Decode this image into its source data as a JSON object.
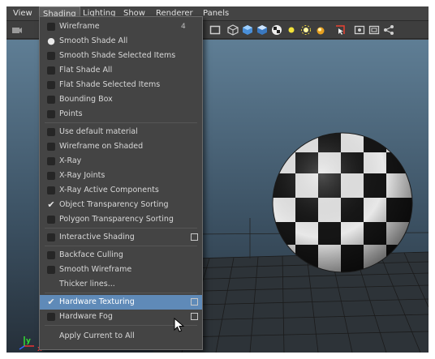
{
  "menubar": {
    "items": [
      {
        "label": "View"
      },
      {
        "label": "Shading"
      },
      {
        "label": "Lighting"
      },
      {
        "label": "Show"
      },
      {
        "label": "Renderer"
      },
      {
        "label": "Panels"
      }
    ]
  },
  "toolbar": {
    "icons": [
      "camera-icon",
      "cube-wire-icon",
      "cube-shaded-icon",
      "cube-smooth-icon",
      "checker-icon",
      "light-icon",
      "sun-icon",
      "lights-icon",
      "select-icon",
      "frame-icon",
      "film-gate-icon",
      "share-icon"
    ]
  },
  "shading_menu": {
    "items": [
      {
        "label": "Wireframe",
        "hotkey": "4",
        "state": "none"
      },
      {
        "label": "Smooth Shade All",
        "state": "radio"
      },
      {
        "label": "Smooth Shade Selected Items",
        "state": "none"
      },
      {
        "label": "Flat Shade All",
        "state": "none"
      },
      {
        "label": "Flat Shade Selected Items",
        "state": "none"
      },
      {
        "label": "Bounding Box",
        "state": "none"
      },
      {
        "label": "Points",
        "state": "none"
      },
      {
        "label": "Use default material",
        "state": "box"
      },
      {
        "label": "Wireframe on Shaded",
        "state": "box"
      },
      {
        "label": "X-Ray",
        "state": "box"
      },
      {
        "label": "X-Ray Joints",
        "state": "box"
      },
      {
        "label": "X-Ray Active Components",
        "state": "box"
      },
      {
        "label": "Object Transparency Sorting",
        "state": "check"
      },
      {
        "label": "Polygon Transparency Sorting",
        "state": "box"
      },
      {
        "label": "Interactive Shading",
        "state": "box",
        "option_box": true
      },
      {
        "label": "Backface Culling",
        "state": "box"
      },
      {
        "label": "Smooth Wireframe",
        "state": "box"
      },
      {
        "label": "Thicker lines...",
        "state": "none"
      },
      {
        "label": "Hardware Texturing",
        "state": "check",
        "option_box": true,
        "highlighted": true
      },
      {
        "label": "Hardware Fog",
        "state": "box",
        "option_box": true
      },
      {
        "label": "Apply Current to All",
        "state": "none"
      }
    ]
  },
  "viewport": {
    "axis_y": "y",
    "axis_x": "x"
  },
  "colors": {
    "menu_bg": "#444444",
    "highlight": "#5f8ab8",
    "checker_dark": "#151515",
    "checker_light": "#e8e8e8"
  }
}
